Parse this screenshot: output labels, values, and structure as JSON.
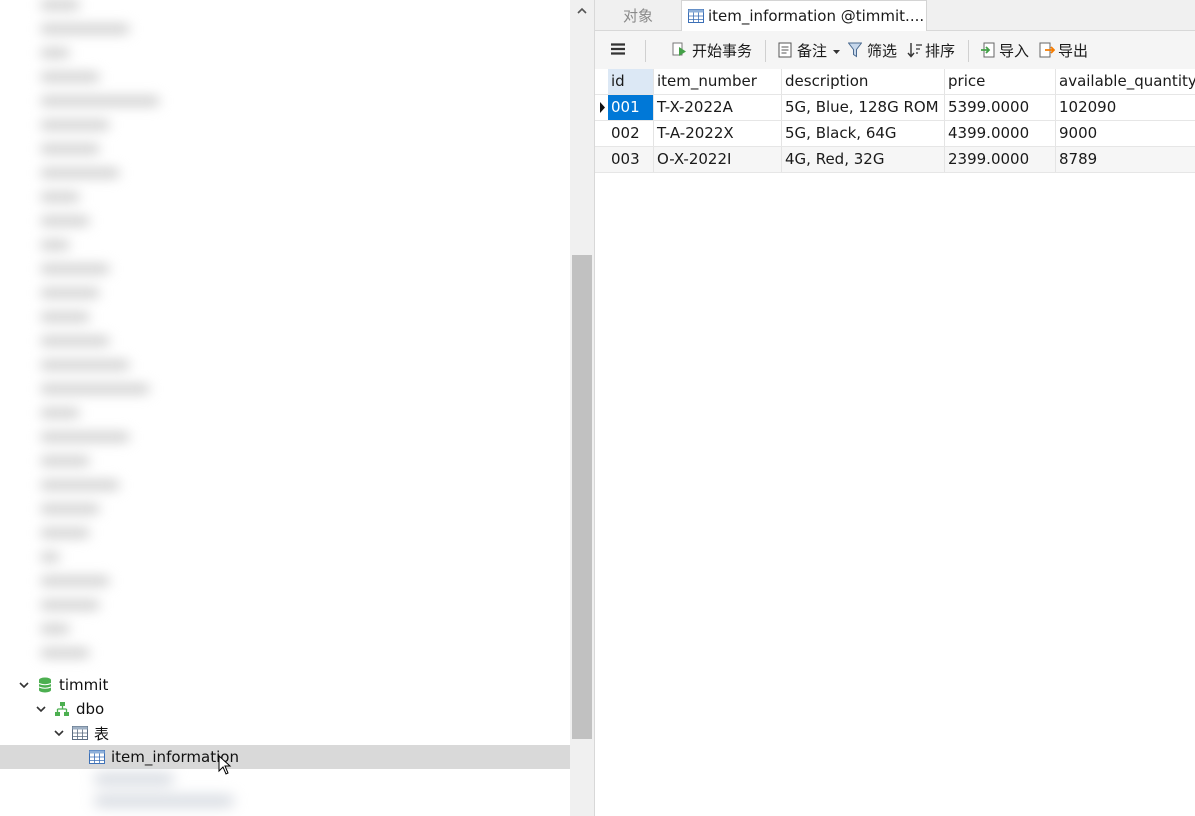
{
  "navigator": {
    "tree": {
      "database": "timmit",
      "schema": "dbo",
      "tables_folder": "表",
      "selected_table": "item_information"
    }
  },
  "tabs": {
    "objects": "对象",
    "active": "item_information @timmit...."
  },
  "toolbar": {
    "begin_transaction": "开始事务",
    "memo": "备注",
    "filter": "筛选",
    "sort": "排序",
    "import": "导入",
    "export": "导出"
  },
  "grid": {
    "columns": [
      "id",
      "item_number",
      "description",
      "price",
      "available_quantity"
    ],
    "rows": [
      {
        "id": "001",
        "item_number": "T-X-2022A",
        "description": "5G, Blue, 128G ROM",
        "price": "5399.0000",
        "available_quantity": "102090"
      },
      {
        "id": "002",
        "item_number": "T-A-2022X",
        "description": "5G, Black, 64G",
        "price": "4399.0000",
        "available_quantity": "9000"
      },
      {
        "id": "003",
        "item_number": "O-X-2022I",
        "description": "4G, Red, 32G",
        "price": "2399.0000",
        "available_quantity": "8789"
      }
    ]
  },
  "colors": {
    "selection": "#0078d7",
    "db_icon": "#4caf50",
    "schema_icon": "#4caf50",
    "table_icon": "#3b6fb6"
  },
  "icons": {
    "database": "database-icon",
    "schema": "schema-icon",
    "table": "table-icon",
    "menu": "hamburger-menu-icon",
    "begin_transaction": "play-icon",
    "memo": "memo-icon",
    "filter": "filter-icon",
    "sort": "sort-icon",
    "import": "import-icon",
    "export": "export-icon"
  }
}
